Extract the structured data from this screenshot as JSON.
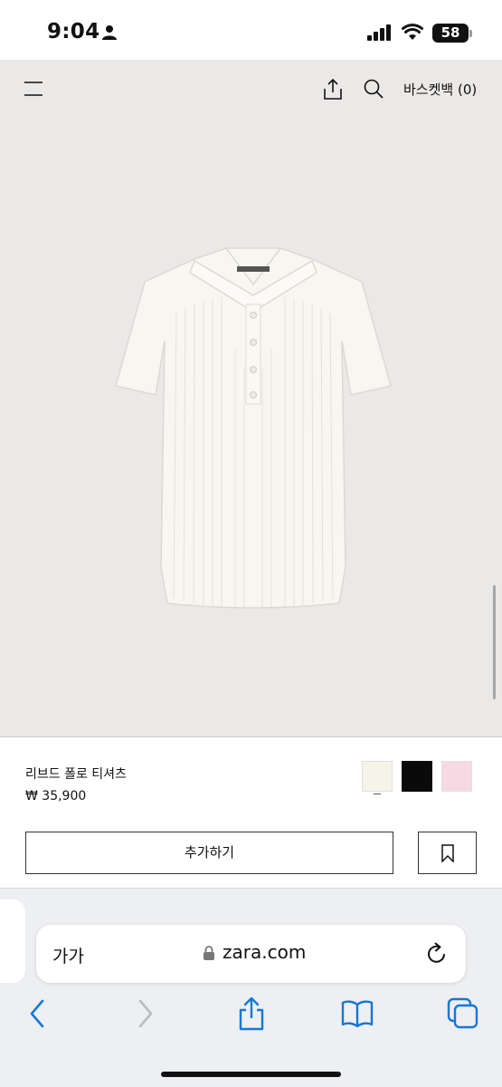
{
  "status_bar": {
    "time": "9:04",
    "battery_level": "58"
  },
  "header": {
    "menu_icon": "hamburger-menu-icon",
    "share_icon": "share-icon",
    "search_icon": "search-icon",
    "basket_label": "바스켓백 (0)"
  },
  "product": {
    "name": "리브드 폴로 티셔츠",
    "price": "₩ 35,900",
    "colors": [
      "#f6f3e9",
      "#0a0a0a",
      "#f7d9e4"
    ],
    "selected_color_index": 0,
    "add_button_label": "추가하기",
    "bookmark_icon": "bookmark-icon"
  },
  "browser": {
    "text_size_label": "가가",
    "url": "zara.com",
    "lock_icon": "lock-icon",
    "reload_icon": "reload-icon",
    "toolbar_icons": [
      "back-icon",
      "forward-icon",
      "share-icon",
      "bookmarks-icon",
      "tabs-icon"
    ]
  }
}
